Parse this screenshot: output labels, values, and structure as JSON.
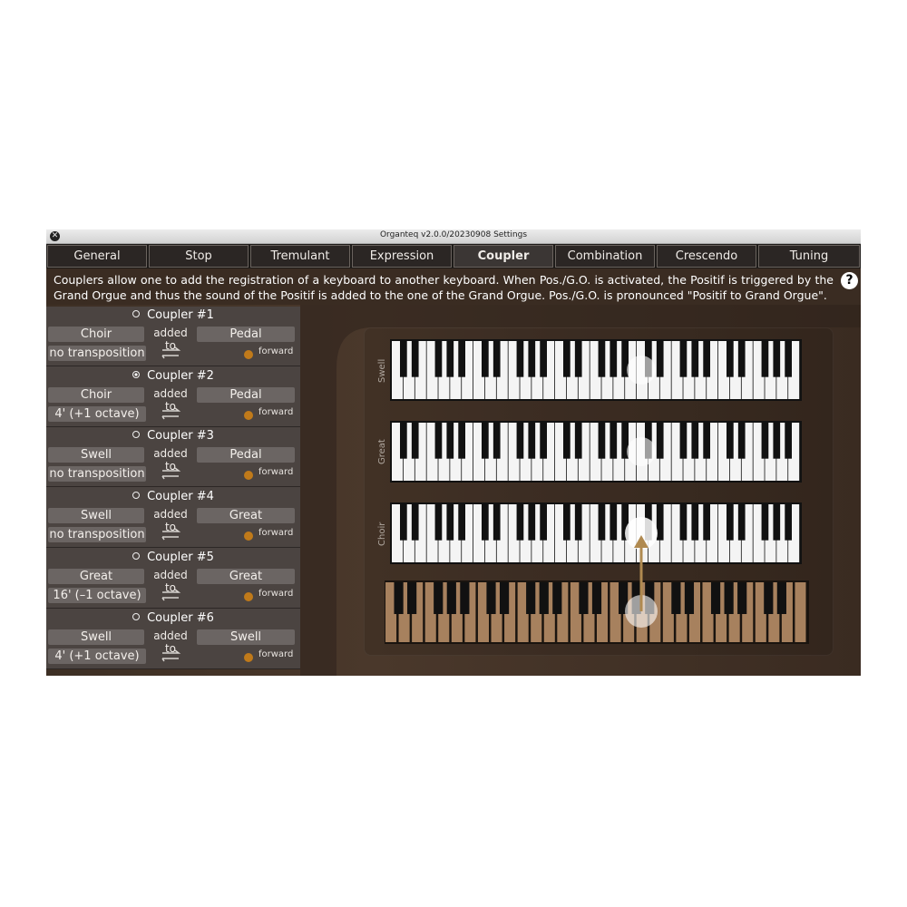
{
  "window": {
    "title": "Organteq v2.0.0/20230908 Settings"
  },
  "tabs": [
    {
      "label": "General"
    },
    {
      "label": "Stop"
    },
    {
      "label": "Tremulant"
    },
    {
      "label": "Expression"
    },
    {
      "label": "Coupler"
    },
    {
      "label": "Combination"
    },
    {
      "label": "Crescendo"
    },
    {
      "label": "Tuning"
    }
  ],
  "active_tab": "Coupler",
  "description": "Couplers allow one to add the registration of a keyboard to another keyboard. When Pos./G.O. is activated, the Positif is triggered by the Grand Orgue and thus the sound of the Positif is added to the one of the Grand Orgue. Pos./G.O. is pronounced \"Positif to Grand Orgue\".",
  "help_icon": "question-mark-icon",
  "couplers": [
    {
      "name": "Coupler #1",
      "selected": false,
      "from": "Choir",
      "added_to": "added to",
      "to": "Pedal",
      "transposition": "no transposition",
      "direction": "forward"
    },
    {
      "name": "Coupler #2",
      "selected": true,
      "from": "Choir",
      "added_to": "added to",
      "to": "Pedal",
      "transposition": "4'  (+1 octave)",
      "direction": "forward"
    },
    {
      "name": "Coupler #3",
      "selected": false,
      "from": "Swell",
      "added_to": "added to",
      "to": "Pedal",
      "transposition": "no transposition",
      "direction": "forward"
    },
    {
      "name": "Coupler #4",
      "selected": false,
      "from": "Swell",
      "added_to": "added to",
      "to": "Great",
      "transposition": "no transposition",
      "direction": "forward"
    },
    {
      "name": "Coupler #5",
      "selected": false,
      "from": "Great",
      "added_to": "added to",
      "to": "Great",
      "transposition": "16'  (–1 octave)",
      "direction": "forward"
    },
    {
      "name": "Coupler #6",
      "selected": false,
      "from": "Swell",
      "added_to": "added to",
      "to": "Swell",
      "transposition": "4'  (+1 octave)",
      "direction": "forward"
    }
  ],
  "keyboards": [
    {
      "label": "Swell"
    },
    {
      "label": "Great"
    },
    {
      "label": "Choir"
    }
  ],
  "colors": {
    "accent_dot": "#c07a1a",
    "arrow": "#b08a50"
  }
}
